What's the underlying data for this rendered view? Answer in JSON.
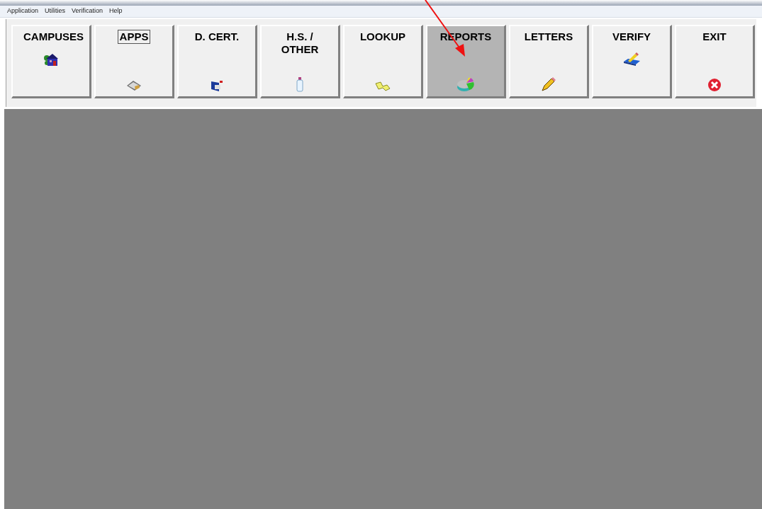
{
  "menu": [
    "Application",
    "Utilities",
    "Verification",
    "Help"
  ],
  "toolbar": [
    {
      "label": "CAMPUSES",
      "selected": false,
      "focused": false
    },
    {
      "label": "APPS",
      "selected": false,
      "focused": true
    },
    {
      "label": "D. CERT.",
      "selected": false,
      "focused": false
    },
    {
      "label": "H.S. / OTHER",
      "selected": false,
      "focused": false
    },
    {
      "label": "LOOKUP",
      "selected": false,
      "focused": false
    },
    {
      "label": "REPORTS",
      "selected": true,
      "focused": false
    },
    {
      "label": "LETTERS",
      "selected": false,
      "focused": false
    },
    {
      "label": "VERIFY",
      "selected": false,
      "focused": false
    },
    {
      "label": "EXIT",
      "selected": false,
      "focused": false
    }
  ]
}
